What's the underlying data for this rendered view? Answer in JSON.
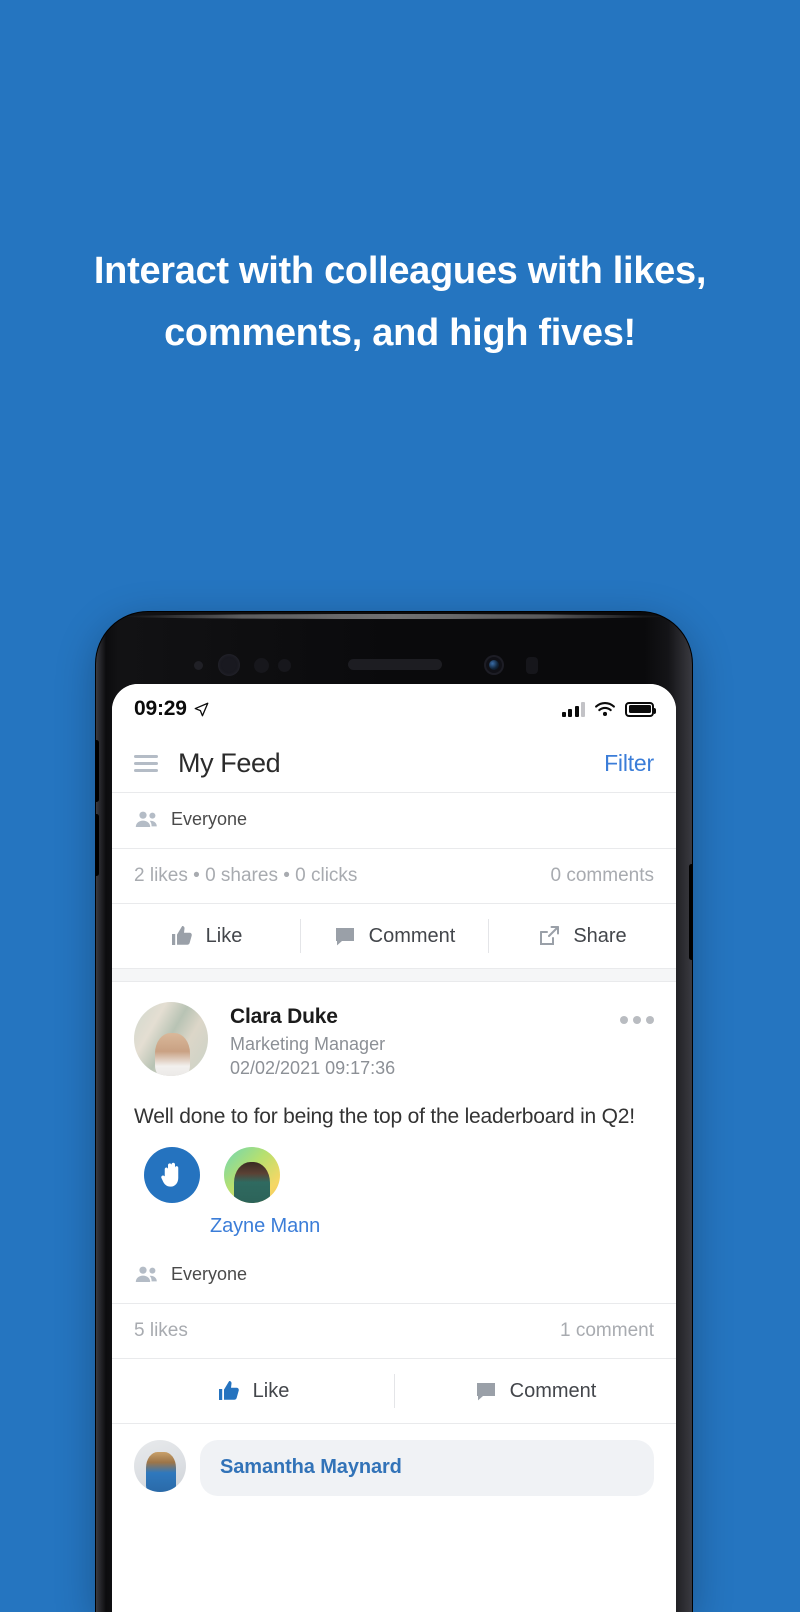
{
  "headline": "Interact with colleagues with likes, comments, and high fives!",
  "background_color": "#2575c0",
  "accent_color": "#3b7dd8",
  "status_bar": {
    "time": "09:29",
    "location_icon": "location-arrow-icon",
    "signal_icon": "cellular-signal-icon",
    "wifi_icon": "wifi-icon",
    "battery_icon": "battery-full-icon"
  },
  "header": {
    "menu_icon": "hamburger-menu-icon",
    "title": "My Feed",
    "filter_label": "Filter"
  },
  "posts": [
    {
      "audience_icon": "people-group-icon",
      "audience": "Everyone",
      "stats_left": "2 likes  •  0 shares  •  0 clicks",
      "stats_right": "0 comments",
      "actions": [
        {
          "icon": "thumbs-up-icon",
          "label": "Like",
          "active": false
        },
        {
          "icon": "comment-bubble-icon",
          "label": "Comment",
          "active": false
        },
        {
          "icon": "share-external-icon",
          "label": "Share",
          "active": false
        }
      ]
    },
    {
      "author": "Clara Duke",
      "role": "Marketing Manager",
      "timestamp": "02/02/2021 09:17:36",
      "more_icon": "more-options-icon",
      "avatar_icon": "user-avatar",
      "text": "Well done to for being the top of the leaderboard in Q2!",
      "highfive_icon": "high-five-hand-icon",
      "recipient_name": "Zayne Mann",
      "audience_icon": "people-group-icon",
      "audience": "Everyone",
      "stats_left": "5 likes",
      "stats_right": "1 comment",
      "actions": [
        {
          "icon": "thumbs-up-icon",
          "label": "Like",
          "active": true
        },
        {
          "icon": "comment-bubble-icon",
          "label": "Comment",
          "active": false
        }
      ],
      "comment": {
        "avatar_icon": "user-avatar",
        "author": "Samantha Maynard"
      }
    }
  ]
}
